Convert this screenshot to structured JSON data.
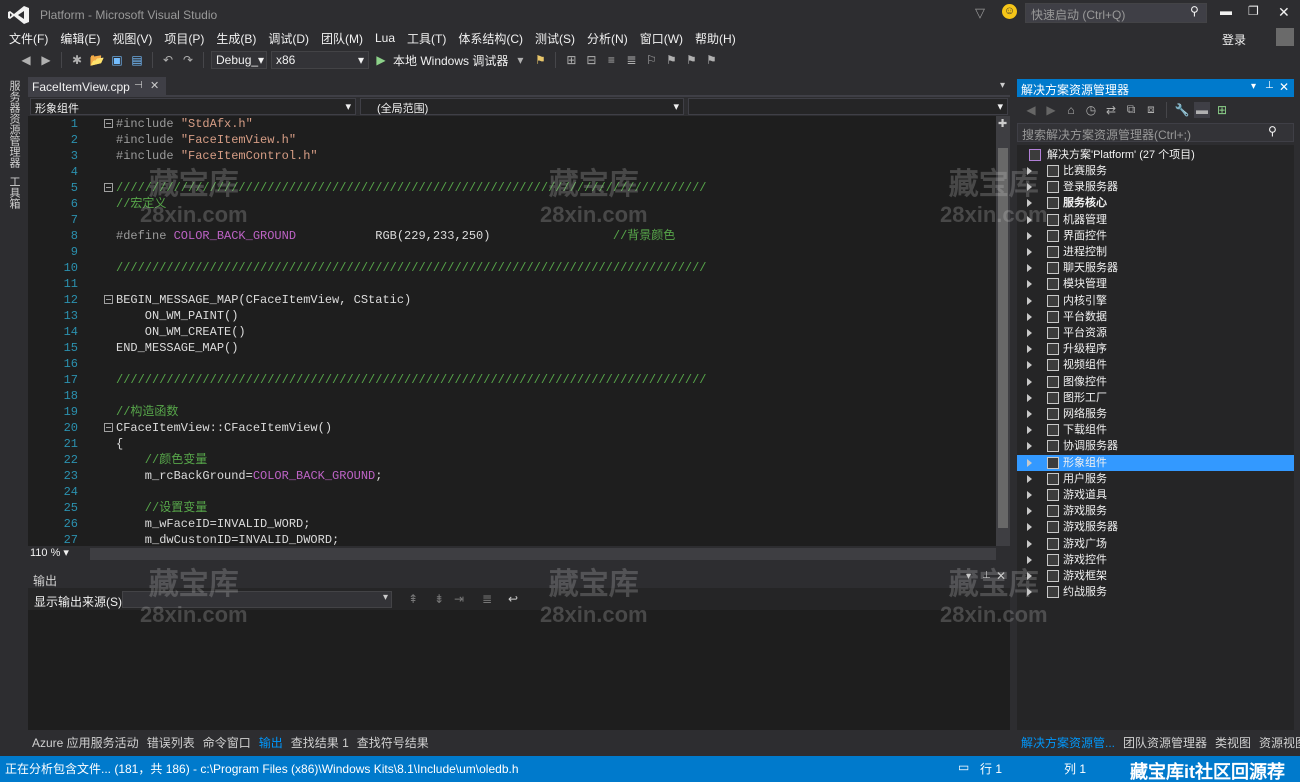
{
  "window": {
    "title": "Platform - Microsoft Visual Studio",
    "quick_launch_placeholder": "快速启动 (Ctrl+Q)",
    "login": "登录"
  },
  "menu": [
    "文件(F)",
    "编辑(E)",
    "视图(V)",
    "项目(P)",
    "生成(B)",
    "调试(D)",
    "团队(M)",
    "Lua",
    "工具(T)",
    "体系结构(C)",
    "测试(S)",
    "分析(N)",
    "窗口(W)",
    "帮助(H)"
  ],
  "toolbar": {
    "config": "Debug_",
    "platform": "x86",
    "run_label": "本地 Windows 调试器"
  },
  "left_strip": {
    "tab1": "服务器资源管理器",
    "tab2": "工具箱"
  },
  "editor": {
    "tab_label": "FaceItemView.cpp",
    "scope_left": "形象组件",
    "scope_right": "(全局范围)",
    "zoom": "110 %",
    "lines": [
      {
        "n": "1",
        "segs": [
          {
            "c": "kw-pp",
            "t": "#include "
          },
          {
            "c": "str",
            "t": "\"StdAfx.h\""
          }
        ],
        "fold": true
      },
      {
        "n": "2",
        "segs": [
          {
            "c": "kw-pp",
            "t": "#include "
          },
          {
            "c": "str",
            "t": "\"FaceItemView.h\""
          }
        ]
      },
      {
        "n": "3",
        "segs": [
          {
            "c": "kw-pp",
            "t": "#include "
          },
          {
            "c": "str",
            "t": "\"FaceItemControl.h\""
          }
        ]
      },
      {
        "n": "4",
        "segs": []
      },
      {
        "n": "5",
        "segs": [
          {
            "c": "cmt",
            "t": "//////////////////////////////////////////////////////////////////////////////////"
          }
        ],
        "fold": true
      },
      {
        "n": "6",
        "segs": [
          {
            "c": "cmt",
            "t": "//宏定义"
          }
        ]
      },
      {
        "n": "7",
        "segs": []
      },
      {
        "n": "8",
        "segs": [
          {
            "c": "kw-pp",
            "t": "#define "
          },
          {
            "c": "mac",
            "t": "COLOR_BACK_GROUND"
          },
          {
            "c": "",
            "t": "           RGB(229,233,250)                 "
          },
          {
            "c": "cmt",
            "t": "//背景颜色"
          }
        ]
      },
      {
        "n": "9",
        "segs": []
      },
      {
        "n": "10",
        "segs": [
          {
            "c": "cmt",
            "t": "//////////////////////////////////////////////////////////////////////////////////"
          }
        ]
      },
      {
        "n": "11",
        "segs": []
      },
      {
        "n": "12",
        "segs": [
          {
            "c": "",
            "t": "BEGIN_MESSAGE_MAP(CFaceItemView, CStatic)"
          }
        ],
        "fold": true
      },
      {
        "n": "13",
        "segs": [
          {
            "c": "",
            "t": "    ON_WM_PAINT()"
          }
        ]
      },
      {
        "n": "14",
        "segs": [
          {
            "c": "",
            "t": "    ON_WM_CREATE()"
          }
        ]
      },
      {
        "n": "15",
        "segs": [
          {
            "c": "",
            "t": "END_MESSAGE_MAP()"
          }
        ]
      },
      {
        "n": "16",
        "segs": []
      },
      {
        "n": "17",
        "segs": [
          {
            "c": "cmt",
            "t": "//////////////////////////////////////////////////////////////////////////////////"
          }
        ]
      },
      {
        "n": "18",
        "segs": []
      },
      {
        "n": "19",
        "segs": [
          {
            "c": "cmt",
            "t": "//构造函数"
          }
        ]
      },
      {
        "n": "20",
        "segs": [
          {
            "c": "",
            "t": "CFaceItemView::CFaceItemView()"
          }
        ],
        "fold": true
      },
      {
        "n": "21",
        "segs": [
          {
            "c": "",
            "t": "{"
          }
        ]
      },
      {
        "n": "22",
        "segs": [
          {
            "c": "cmt",
            "t": "    //颜色变量"
          }
        ]
      },
      {
        "n": "23",
        "segs": [
          {
            "c": "",
            "t": "    m_rcBackGround="
          },
          {
            "c": "mac",
            "t": "COLOR_BACK_GROUND"
          },
          {
            "c": "",
            "t": ";"
          }
        ]
      },
      {
        "n": "24",
        "segs": []
      },
      {
        "n": "25",
        "segs": [
          {
            "c": "cmt",
            "t": "    //设置变量"
          }
        ]
      },
      {
        "n": "26",
        "segs": [
          {
            "c": "",
            "t": "    m_wFaceID=INVALID_WORD;"
          }
        ]
      },
      {
        "n": "27",
        "segs": [
          {
            "c": "",
            "t": "    m_dwCustonID=INVALID_DWORD;"
          }
        ]
      }
    ]
  },
  "output": {
    "title": "输出",
    "source_label": "显示输出来源(S):"
  },
  "bottom_tabs": [
    "Azure 应用服务活动",
    "错误列表",
    "命令窗口",
    "输出",
    "查找结果 1",
    "查找符号结果"
  ],
  "bottom_tab_active": "输出",
  "solution_explorer": {
    "title": "解决方案资源管理器",
    "search_placeholder": "搜索解决方案资源管理器(Ctrl+;)",
    "root": "解决方案'Platform' (27 个项目)",
    "items": [
      "比赛服务",
      "登录服务器",
      "服务核心",
      "机器管理",
      "界面控件",
      "进程控制",
      "聊天服务器",
      "模块管理",
      "内核引擎",
      "平台数据",
      "平台资源",
      "升级程序",
      "视频组件",
      "图像控件",
      "图形工厂",
      "网络服务",
      "下载组件",
      "协调服务器",
      "形象组件",
      "用户服务",
      "游戏道具",
      "游戏服务",
      "游戏服务器",
      "游戏广场",
      "游戏控件",
      "游戏框架",
      "约战服务"
    ],
    "bold_item": "服务核心",
    "selected_item": "形象组件",
    "bottom_tabs": [
      "解决方案资源管...",
      "团队资源管理器",
      "类视图",
      "资源视图"
    ]
  },
  "status": {
    "text": "正在分析包含文件... (181，共 186) - c:\\Program Files (x86)\\Windows Kits\\8.1\\Include\\um\\oledb.h",
    "row": "行 1",
    "col": "列 1",
    "brand": "藏宝库it社区回源荐"
  },
  "watermark": {
    "cn": "藏宝库",
    "url": "28xin.com"
  },
  "colors": {
    "accent": "#007acc",
    "selection": "#3399ff",
    "editor_bg": "#1e1e1e",
    "chrome_bg": "#2d2d30"
  }
}
